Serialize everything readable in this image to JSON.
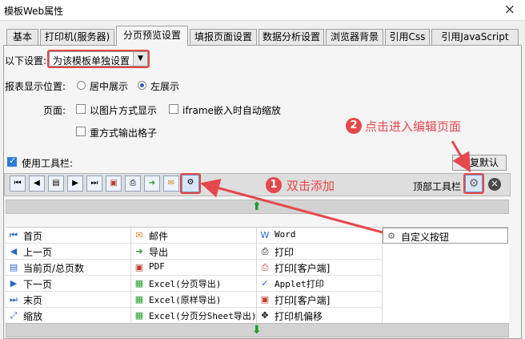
{
  "window": {
    "title": "模板Web属性",
    "close_icon": "×"
  },
  "tabs": [
    {
      "label": "基本"
    },
    {
      "label": "打印机(服务器)"
    },
    {
      "label": "分页预览设置",
      "active": true
    },
    {
      "label": "填报页面设置"
    },
    {
      "label": "数据分析设置"
    },
    {
      "label": "浏览器背景"
    },
    {
      "label": "引用Css"
    },
    {
      "label": "引用JavaScript"
    }
  ],
  "settings": {
    "scope_label": "以下设置:",
    "scope_value": "为该模板单独设置",
    "position_label": "报表显示位置:",
    "center_label": "居中展示",
    "left_label": "左展示",
    "page_label": "页面:",
    "image_label": "以图片方式显示",
    "iframe_label": "iframe嵌入时自动缩放",
    "reprint_label": "重方式输出格子",
    "toolbar_label": "使用工具栏:",
    "restore_label": "恢复默认",
    "top_toolbar_label": "顶部工具栏"
  },
  "annotations": {
    "step1_num": "1",
    "step1_text": "双击添加",
    "step2_num": "2",
    "step2_text": "点击进入编辑页面"
  },
  "colors": {
    "accent_red": "#e5484d",
    "green_arrow": "#1e9c2a"
  },
  "toolbar_icons": [
    "first-page-icon",
    "prev-page-icon",
    "current-page-icon",
    "next-page-icon",
    "last-page-icon",
    "pdf-icon",
    "print-icon",
    "export-icon",
    "email-icon",
    "gear-icon"
  ],
  "grid": {
    "col1": [
      "首页",
      "上一页",
      "当前页/总页数",
      "下一页",
      "末页",
      "缩放"
    ],
    "col2": [
      "邮件",
      "导出",
      "PDF",
      "Excel(分页导出)",
      "Excel(原样导出)",
      "Excel(分页分Sheet导出)"
    ],
    "col3": [
      "Word",
      "打印",
      "打印[客户端]",
      "Applet打印",
      "打印[客户端]",
      "打印机偏移"
    ],
    "col4": [
      "自定义按钮"
    ]
  }
}
